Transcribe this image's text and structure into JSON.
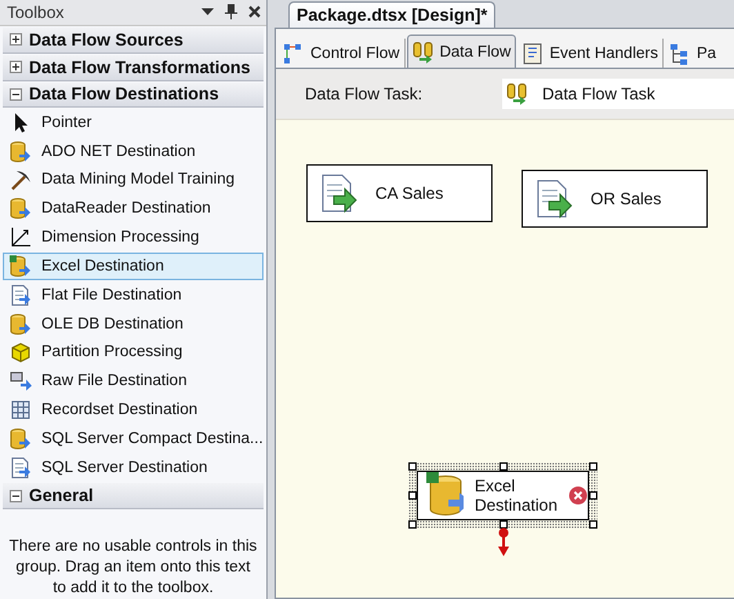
{
  "toolbox": {
    "title": "Toolbox",
    "groups": [
      {
        "label": "Data Flow Sources",
        "expanded": false
      },
      {
        "label": "Data Flow Transformations",
        "expanded": false
      },
      {
        "label": "Data Flow Destinations",
        "expanded": true,
        "items": [
          {
            "label": "Pointer",
            "kind": "pointer",
            "selected": false
          },
          {
            "label": "ADO NET Destination",
            "kind": "dbdest",
            "selected": false
          },
          {
            "label": "Data Mining Model Training",
            "kind": "mining",
            "selected": false
          },
          {
            "label": "DataReader Destination",
            "kind": "dbdest",
            "selected": false
          },
          {
            "label": "Dimension Processing",
            "kind": "dimension",
            "selected": false
          },
          {
            "label": "Excel Destination",
            "kind": "excel",
            "selected": true
          },
          {
            "label": "Flat File Destination",
            "kind": "flatfile",
            "selected": false
          },
          {
            "label": "OLE DB Destination",
            "kind": "dbdest",
            "selected": false
          },
          {
            "label": "Partition Processing",
            "kind": "partition",
            "selected": false
          },
          {
            "label": "Raw File Destination",
            "kind": "rawfile",
            "selected": false
          },
          {
            "label": "Recordset Destination",
            "kind": "recordset",
            "selected": false
          },
          {
            "label": "SQL Server Compact Destina...",
            "kind": "compact",
            "selected": false
          },
          {
            "label": "SQL Server Destination",
            "kind": "sqlserver",
            "selected": false
          }
        ]
      },
      {
        "label": "General",
        "expanded": true,
        "message": "There are no usable controls in this group. Drag an item onto this text to add it to the toolbox."
      }
    ]
  },
  "document_tab": {
    "label": "Package.dtsx [Design]*"
  },
  "designer_tabs": [
    {
      "label": "Control Flow",
      "kind": "control",
      "selected": false
    },
    {
      "label": "Data Flow",
      "kind": "dataflow",
      "selected": true
    },
    {
      "label": "Event Handlers",
      "kind": "events",
      "selected": false
    },
    {
      "label": "Pa",
      "kind": "explorer",
      "selected": false
    }
  ],
  "task": {
    "label": "Data Flow Task:",
    "value": "Data Flow Task"
  },
  "nodes": [
    {
      "label": "CA Sales",
      "kind": "source",
      "selected": false,
      "error": false
    },
    {
      "label": "OR Sales",
      "kind": "source",
      "selected": false,
      "error": false
    },
    {
      "label": "Excel Destination",
      "kind": "excel",
      "selected": true,
      "error": true
    }
  ]
}
